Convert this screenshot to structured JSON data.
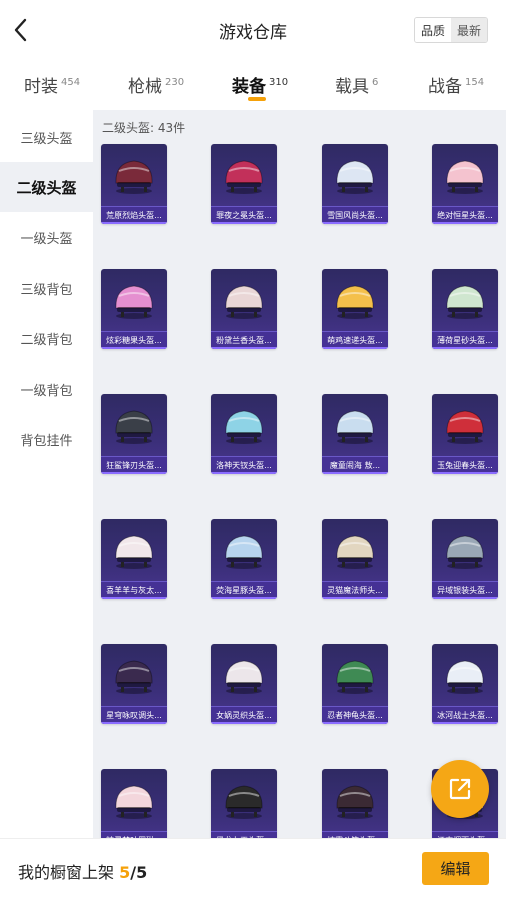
{
  "header": {
    "title": "游戏仓库",
    "sort_options": [
      "品质",
      "最新"
    ]
  },
  "tabs": [
    {
      "label": "时装",
      "count": "454"
    },
    {
      "label": "枪械",
      "count": "230"
    },
    {
      "label": "装备",
      "count": "310",
      "active": true
    },
    {
      "label": "载具",
      "count": "6"
    },
    {
      "label": "战备",
      "count": "154"
    }
  ],
  "sidebar": {
    "items": [
      {
        "label": "三级头盔"
      },
      {
        "label": "二级头盔",
        "active": true
      },
      {
        "label": "一级头盔"
      },
      {
        "label": "三级背包"
      },
      {
        "label": "二级背包"
      },
      {
        "label": "一级背包"
      },
      {
        "label": "背包挂件"
      }
    ]
  },
  "content": {
    "section_title": "二级头盔: 43件",
    "items": [
      {
        "name": "荒原烈焰头盔...",
        "icon": "helmet-icon",
        "color": "#7a2a3a"
      },
      {
        "name": "罪夜之冕头盔...",
        "icon": "helmet-icon",
        "color": "#c2305a"
      },
      {
        "name": "雪国风尚头盔...",
        "icon": "helmet-icon",
        "color": "#dde6f3"
      },
      {
        "name": "绝对恒星头盔...",
        "icon": "helmet-icon",
        "color": "#f4c3cf"
      },
      {
        "name": "炫彩糖果头盔...",
        "icon": "helmet-icon",
        "color": "#e58fd0"
      },
      {
        "name": "粉黛兰香头盔...",
        "icon": "helmet-icon",
        "color": "#e9d6d6"
      },
      {
        "name": "萌鸡速递头盔...",
        "icon": "helmet-icon",
        "color": "#f4c04b"
      },
      {
        "name": "薄荷星砂头盔...",
        "icon": "helmet-icon",
        "color": "#cfe6cf"
      },
      {
        "name": "狂鲨锋刃头盔...",
        "icon": "helmet-icon",
        "color": "#3a3f48"
      },
      {
        "name": "洛神天钗头盔...",
        "icon": "helmet-icon",
        "color": "#8ed3e6"
      },
      {
        "name": "魔童闹海 敖...",
        "icon": "helmet-icon",
        "color": "#c9ddef"
      },
      {
        "name": "玉兔迎春头盔...",
        "icon": "helmet-icon",
        "color": "#cf2f3a"
      },
      {
        "name": "喜羊羊与灰太...",
        "icon": "helmet-icon",
        "color": "#f1e7ea"
      },
      {
        "name": "荧海星豚头盔...",
        "icon": "helmet-icon",
        "color": "#b7d4ee"
      },
      {
        "name": "灵猫魔法师头...",
        "icon": "helmet-icon",
        "color": "#e2d6c0"
      },
      {
        "name": "异域银装头盔...",
        "icon": "helmet-icon",
        "color": "#9aa8b6"
      },
      {
        "name": "星穹咏叹调头...",
        "icon": "helmet-icon",
        "color": "#3a2a4e"
      },
      {
        "name": "女娲灵织头盔...",
        "icon": "helmet-icon",
        "color": "#ece6ea"
      },
      {
        "name": "忍者神龟头盔...",
        "icon": "helmet-icon",
        "color": "#3f8a54"
      },
      {
        "name": "冰河战士头盔...",
        "icon": "helmet-icon",
        "color": "#e9eef6"
      },
      {
        "name": "精灵梦叶罗琳...",
        "icon": "helmet-icon",
        "color": "#f3d6dc"
      },
      {
        "name": "墨龙九天头盔...",
        "icon": "helmet-icon",
        "color": "#2a2a2a"
      },
      {
        "name": "炫雾斗笠头盔...",
        "icon": "helmet-icon",
        "color": "#3b2a34"
      },
      {
        "name": "江南烟雨头盔...",
        "icon": "helmet-icon",
        "color": "#d8c7a8"
      }
    ]
  },
  "footer": {
    "label": "我的橱窗上架",
    "current": "5",
    "separator": "/",
    "max": "5",
    "edit_label": "编辑"
  },
  "icons": {
    "back": "chevron-left-icon",
    "share": "share-external-icon"
  },
  "colors": {
    "accent": "#f5a715",
    "card_bg": "#3b2f7a",
    "panel_bg": "#eef0f4"
  }
}
